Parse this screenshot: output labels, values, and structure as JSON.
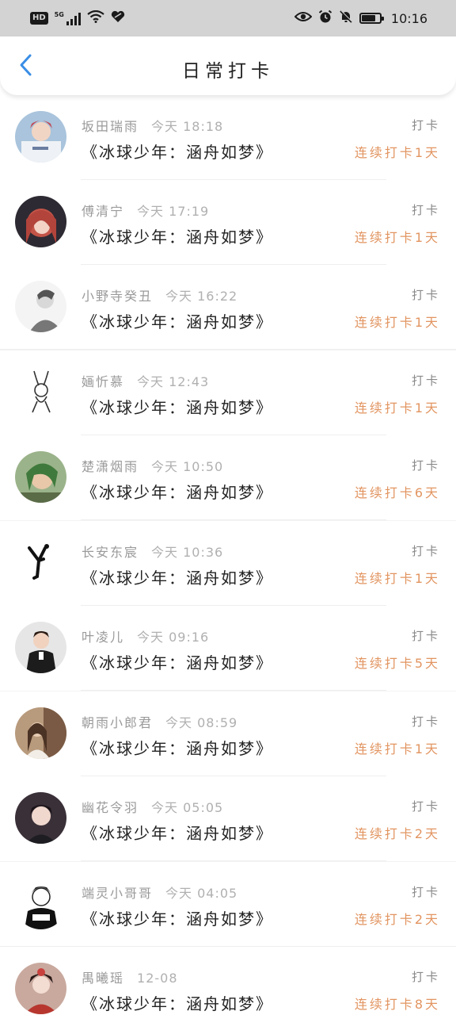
{
  "status_bar": {
    "hd": "HD",
    "network": "5G",
    "time": "10:16"
  },
  "header": {
    "title": "日常打卡"
  },
  "colors": {
    "streak": "#e29561",
    "back_arrow": "#3a8ee6",
    "status_bar_bg": "#d3d3d3"
  },
  "entries": [
    {
      "user": "坂田瑞雨",
      "time": "今天 18:18",
      "book": "《冰球少年：涵舟如梦》",
      "tag": "打卡",
      "streak": "连续打卡1天",
      "avatar": "avatar-1"
    },
    {
      "user": "傅清宁",
      "time": "今天 17:19",
      "book": "《冰球少年：涵舟如梦》",
      "tag": "打卡",
      "streak": "连续打卡1天",
      "avatar": "avatar-2"
    },
    {
      "user": "小野寺癸丑",
      "time": "今天 16:22",
      "book": "《冰球少年：涵舟如梦》",
      "tag": "打卡",
      "streak": "连续打卡1天",
      "avatar": "avatar-3"
    },
    {
      "user": "婳忻慕",
      "time": "今天 12:43",
      "book": "《冰球少年：涵舟如梦》",
      "tag": "打卡",
      "streak": "连续打卡1天",
      "avatar": "avatar-4"
    },
    {
      "user": "楚潇烟雨",
      "time": "今天 10:50",
      "book": "《冰球少年：涵舟如梦》",
      "tag": "打卡",
      "streak": "连续打卡6天",
      "avatar": "avatar-5"
    },
    {
      "user": "长安东宸",
      "time": "今天 10:36",
      "book": "《冰球少年：涵舟如梦》",
      "tag": "打卡",
      "streak": "连续打卡1天",
      "avatar": "avatar-6"
    },
    {
      "user": "叶凌儿",
      "time": "今天 09:16",
      "book": "《冰球少年：涵舟如梦》",
      "tag": "打卡",
      "streak": "连续打卡5天",
      "avatar": "avatar-7"
    },
    {
      "user": "朝雨小郎君",
      "time": "今天 08:59",
      "book": "《冰球少年：涵舟如梦》",
      "tag": "打卡",
      "streak": "连续打卡1天",
      "avatar": "avatar-8"
    },
    {
      "user": "幽花令羽",
      "time": "今天 05:05",
      "book": "《冰球少年：涵舟如梦》",
      "tag": "打卡",
      "streak": "连续打卡2天",
      "avatar": "avatar-9"
    },
    {
      "user": "端灵小哥哥",
      "time": "今天 04:05",
      "book": "《冰球少年：涵舟如梦》",
      "tag": "打卡",
      "streak": "连续打卡2天",
      "avatar": "avatar-10"
    },
    {
      "user": "禺曦瑶",
      "time": "12-08",
      "book": "《冰球少年：涵舟如梦》",
      "tag": "打卡",
      "streak": "连续打卡8天",
      "avatar": "avatar-11"
    }
  ]
}
